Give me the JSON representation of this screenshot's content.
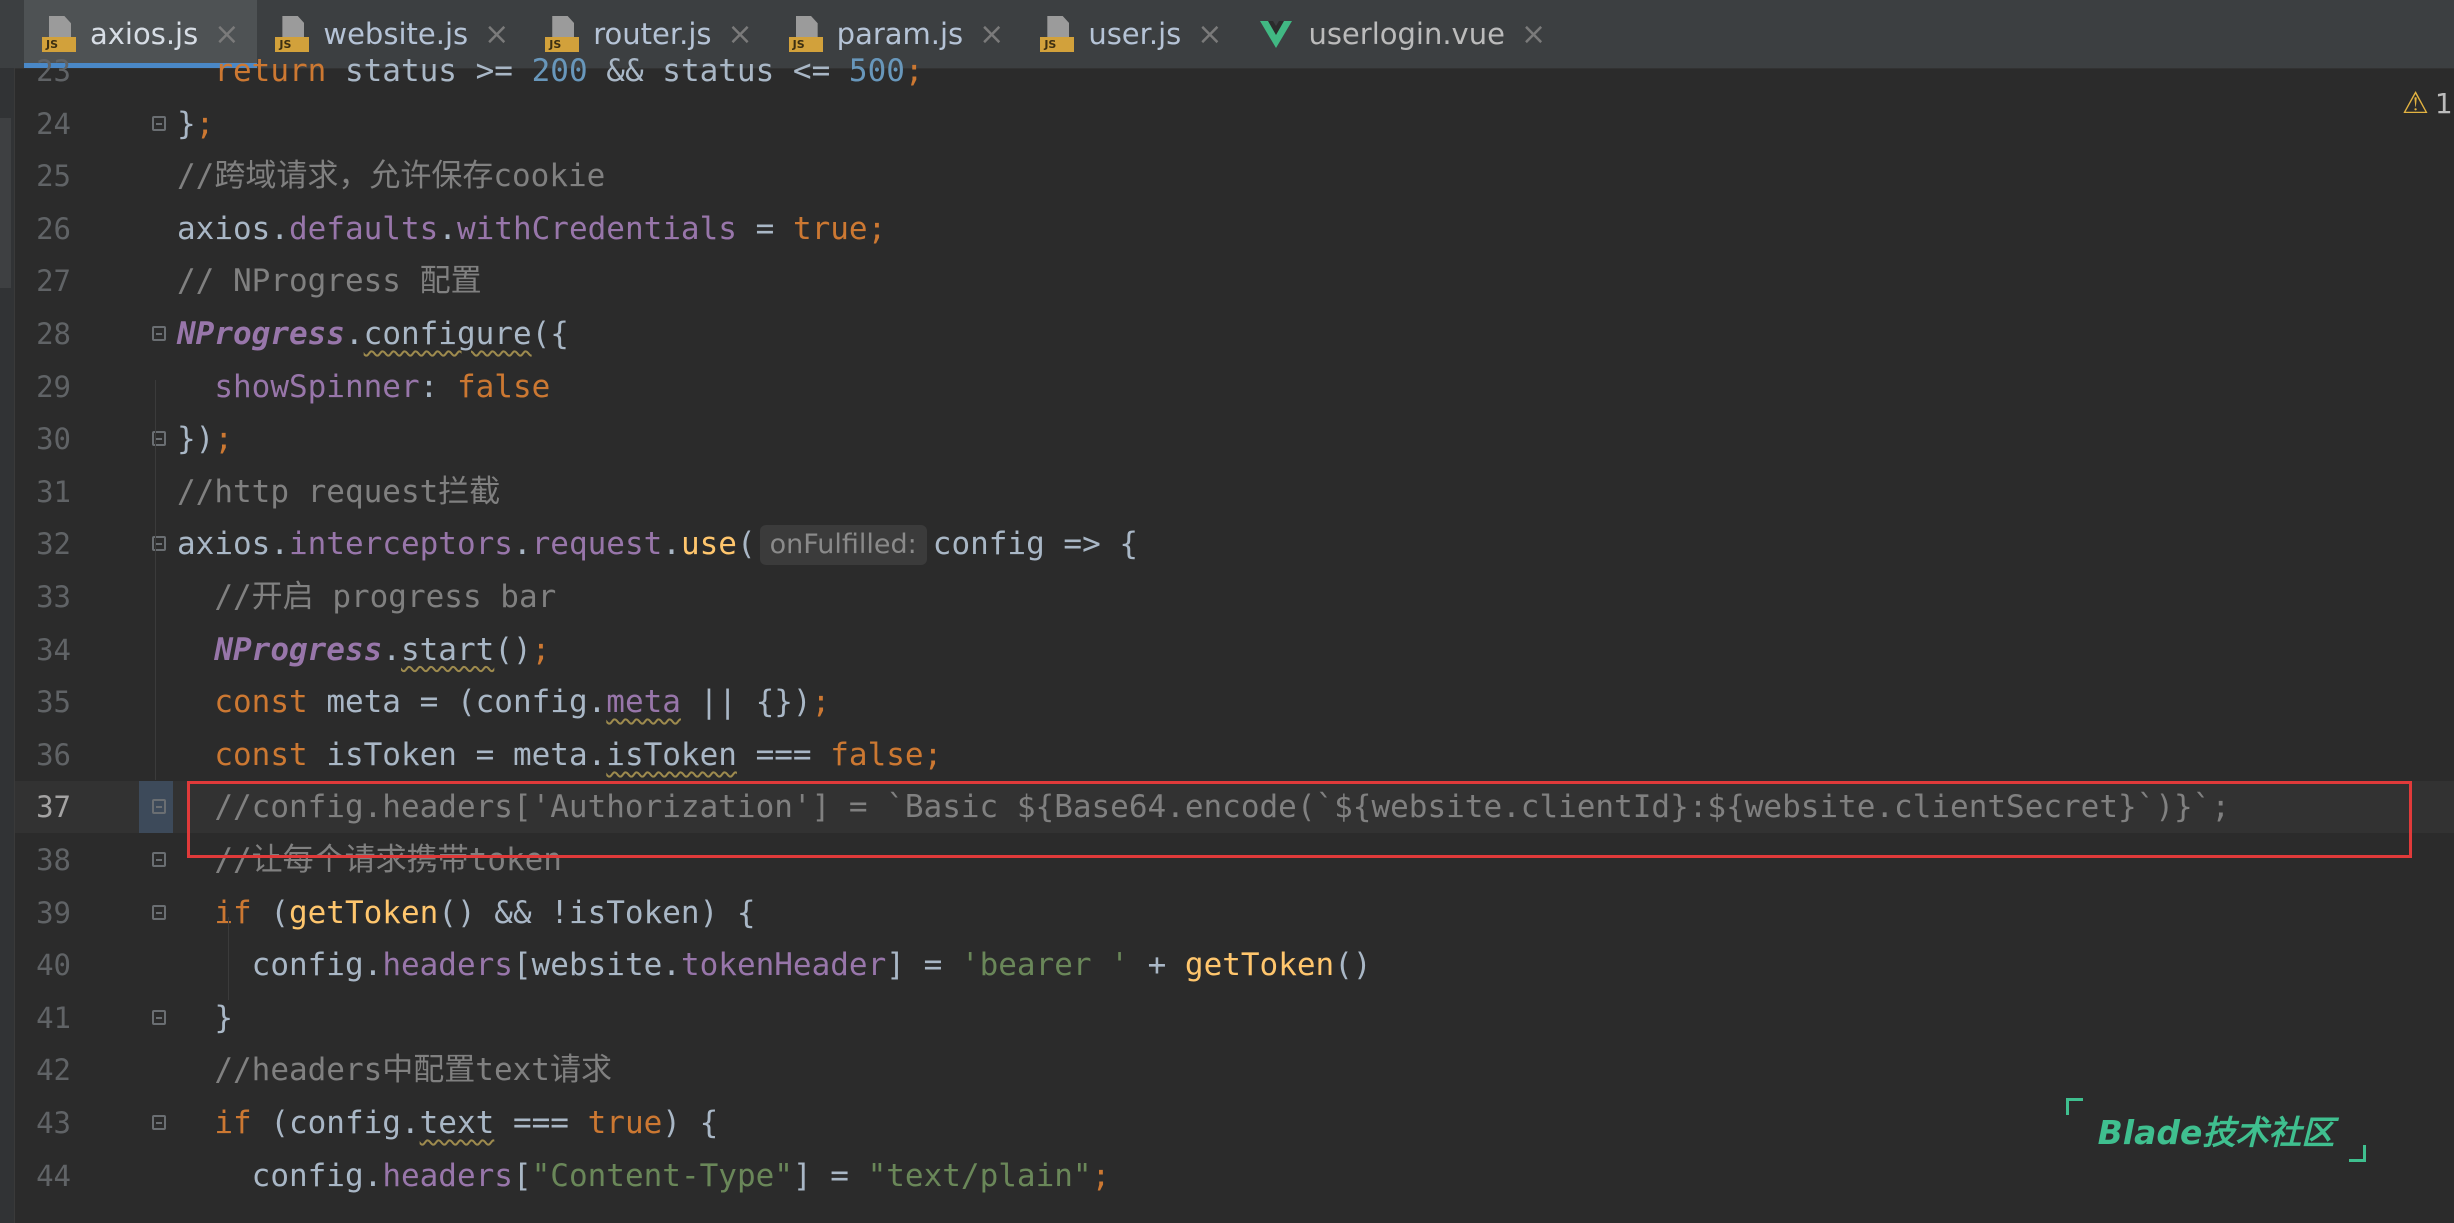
{
  "tabs": [
    {
      "label": "axios.js",
      "icon": "js-file-icon",
      "active": true
    },
    {
      "label": "website.js",
      "icon": "js-file-icon",
      "active": false
    },
    {
      "label": "router.js",
      "icon": "js-file-icon",
      "active": false
    },
    {
      "label": "param.js",
      "icon": "js-file-icon",
      "active": false
    },
    {
      "label": "user.js",
      "icon": "js-file-icon",
      "active": false
    },
    {
      "label": "userlogin.vue",
      "icon": "vue-file-icon",
      "active": false
    }
  ],
  "tab_close_symbol": "×",
  "inspection": {
    "icon": "warning-icon",
    "count": "1"
  },
  "current_line": "37",
  "lines": [
    {
      "num": "23",
      "fold": false,
      "tokens": [
        {
          "t": "  "
        },
        {
          "t": "return",
          "c": "kw"
        },
        {
          "t": " status >= "
        },
        {
          "t": "200",
          "c": "num"
        },
        {
          "t": " && status <= "
        },
        {
          "t": "500",
          "c": "num"
        },
        {
          "t": ";",
          "c": "kw"
        }
      ]
    },
    {
      "num": "24",
      "fold": true,
      "tokens": [
        {
          "t": "}"
        },
        {
          "t": ";",
          "c": "kw"
        }
      ]
    },
    {
      "num": "25",
      "fold": false,
      "tokens": [
        {
          "t": "//跨域请求，允许保存cookie",
          "c": "com"
        }
      ]
    },
    {
      "num": "26",
      "fold": false,
      "tokens": [
        {
          "t": "axios."
        },
        {
          "t": "defaults",
          "c": "prop"
        },
        {
          "t": "."
        },
        {
          "t": "withCredentials",
          "c": "prop"
        },
        {
          "t": " = "
        },
        {
          "t": "true",
          "c": "kw"
        },
        {
          "t": ";",
          "c": "kw"
        }
      ]
    },
    {
      "num": "27",
      "fold": false,
      "tokens": [
        {
          "t": "// NProgress 配置",
          "c": "com"
        }
      ]
    },
    {
      "num": "28",
      "fold": true,
      "tokens": [
        {
          "t": "NProgress",
          "c": "cls"
        },
        {
          "t": "."
        },
        {
          "t": "configure",
          "c": "wavy"
        },
        {
          "t": "({"
        }
      ]
    },
    {
      "num": "29",
      "fold": false,
      "tokens": [
        {
          "t": "  "
        },
        {
          "t": "showSpinner",
          "c": "prop"
        },
        {
          "t": ": "
        },
        {
          "t": "false",
          "c": "kw"
        }
      ]
    },
    {
      "num": "30",
      "fold": true,
      "tokens": [
        {
          "t": "})"
        },
        {
          "t": ";",
          "c": "kw"
        }
      ]
    },
    {
      "num": "31",
      "fold": false,
      "tokens": [
        {
          "t": "//http request拦截",
          "c": "com"
        }
      ]
    },
    {
      "num": "32",
      "fold": true,
      "tokens": [
        {
          "t": "axios."
        },
        {
          "t": "interceptors",
          "c": "prop"
        },
        {
          "t": "."
        },
        {
          "t": "request",
          "c": "prop"
        },
        {
          "t": "."
        },
        {
          "t": "use",
          "c": "fn"
        },
        {
          "t": "("
        },
        {
          "t": "onFulfilled:",
          "c": "hint"
        },
        {
          "t": "config => {"
        }
      ]
    },
    {
      "num": "33",
      "fold": false,
      "tokens": [
        {
          "t": "  "
        },
        {
          "t": "//开启 progress bar",
          "c": "com"
        }
      ]
    },
    {
      "num": "34",
      "fold": false,
      "tokens": [
        {
          "t": "  "
        },
        {
          "t": "NProgress",
          "c": "cls"
        },
        {
          "t": "."
        },
        {
          "t": "start",
          "c": "wavy"
        },
        {
          "t": "()"
        },
        {
          "t": ";",
          "c": "kw"
        }
      ]
    },
    {
      "num": "35",
      "fold": false,
      "tokens": [
        {
          "t": "  "
        },
        {
          "t": "const",
          "c": "kw"
        },
        {
          "t": " meta = (config."
        },
        {
          "t": "meta",
          "c": "prop wavy"
        },
        {
          "t": " || {})"
        },
        {
          "t": ";",
          "c": "kw"
        }
      ]
    },
    {
      "num": "36",
      "fold": false,
      "tokens": [
        {
          "t": "  "
        },
        {
          "t": "const",
          "c": "kw"
        },
        {
          "t": " isToken = meta."
        },
        {
          "t": "isToken",
          "c": "wavy"
        },
        {
          "t": " === "
        },
        {
          "t": "false",
          "c": "kw"
        },
        {
          "t": ";",
          "c": "kw"
        }
      ]
    },
    {
      "num": "37",
      "fold": true,
      "current": true,
      "tokens": [
        {
          "t": "  "
        },
        {
          "t": "//config.headers['Authorization'] = `Basic ${Base64.encode(`${website.clientId}:${website.clientSecret}`)}`;",
          "c": "com"
        }
      ]
    },
    {
      "num": "38",
      "fold": true,
      "tokens": [
        {
          "t": "  "
        },
        {
          "t": "//让每个请求携带token",
          "c": "com"
        }
      ]
    },
    {
      "num": "39",
      "fold": true,
      "tokens": [
        {
          "t": "  "
        },
        {
          "t": "if",
          "c": "kw"
        },
        {
          "t": " ("
        },
        {
          "t": "getToken",
          "c": "fn"
        },
        {
          "t": "() && !isToken) {"
        }
      ]
    },
    {
      "num": "40",
      "fold": false,
      "tokens": [
        {
          "t": "    config."
        },
        {
          "t": "headers",
          "c": "prop"
        },
        {
          "t": "[website."
        },
        {
          "t": "tokenHeader",
          "c": "prop"
        },
        {
          "t": "] = "
        },
        {
          "t": "'bearer '",
          "c": "str"
        },
        {
          "t": " + "
        },
        {
          "t": "getToken",
          "c": "fn"
        },
        {
          "t": "()"
        }
      ]
    },
    {
      "num": "41",
      "fold": true,
      "tokens": [
        {
          "t": "  }"
        }
      ]
    },
    {
      "num": "42",
      "fold": false,
      "tokens": [
        {
          "t": "  "
        },
        {
          "t": "//headers中配置text请求",
          "c": "com"
        }
      ]
    },
    {
      "num": "43",
      "fold": true,
      "tokens": [
        {
          "t": "  "
        },
        {
          "t": "if",
          "c": "kw"
        },
        {
          "t": " (config."
        },
        {
          "t": "text",
          "c": "wavy"
        },
        {
          "t": " === "
        },
        {
          "t": "true",
          "c": "kw"
        },
        {
          "t": ") {"
        }
      ]
    },
    {
      "num": "44",
      "fold": false,
      "tokens": [
        {
          "t": "    config."
        },
        {
          "t": "headers",
          "c": "prop"
        },
        {
          "t": "["
        },
        {
          "t": "\"Content-Type\"",
          "c": "str"
        },
        {
          "t": "] = "
        },
        {
          "t": "\"text/plain\"",
          "c": "str"
        },
        {
          "t": ";",
          "c": "kw"
        }
      ]
    }
  ],
  "watermark": "Blade技术社区",
  "colors": {
    "background": "#2b2b2b",
    "keyword": "#cc7832",
    "string": "#6a8759",
    "number": "#6897bb",
    "property": "#9876aa",
    "function": "#ffc66d",
    "comment": "#808080",
    "highlight_box": "#e03a3a",
    "active_tab_underline": "#4a88c7"
  }
}
